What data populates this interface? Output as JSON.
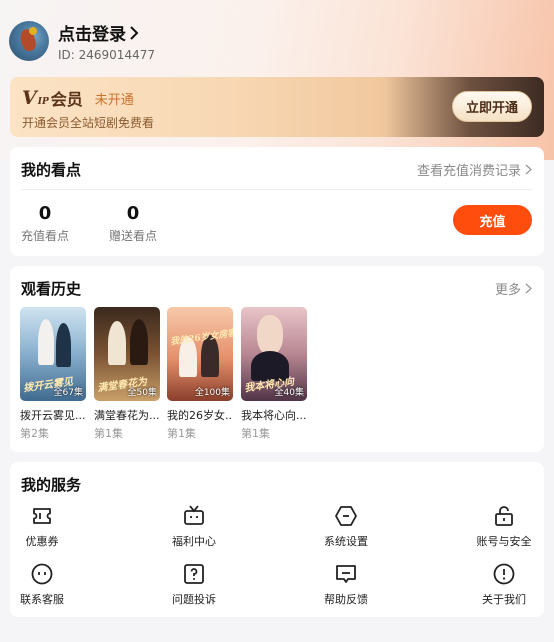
{
  "profile": {
    "login_title": "点击登录",
    "uid": "ID: 2469014477"
  },
  "vip": {
    "badge_v": "V",
    "badge_ip": "IP",
    "name": "会员",
    "status": "未开通",
    "subtitle": "开通会员全站短剧免费看",
    "button": "立即开通"
  },
  "points": {
    "title": "我的看点",
    "link": "查看充值消费记录",
    "recharge_value": "0",
    "recharge_label": "充值看点",
    "gift_value": "0",
    "gift_label": "赠送看点",
    "button": "充值"
  },
  "history": {
    "title": "观看历史",
    "link": "更多",
    "items": [
      {
        "title": "拨开云雾见...",
        "episode": "第2集",
        "badge": "全67集",
        "caption": "拨开云雾见"
      },
      {
        "title": "满堂春花为...",
        "episode": "第1集",
        "badge": "全50集",
        "caption": "满堂春花为"
      },
      {
        "title": "我的26岁女...",
        "episode": "第1集",
        "badge": "全100集",
        "caption": "我的26岁女房客"
      },
      {
        "title": "我本将心向...",
        "episode": "第1集",
        "badge": "全40集",
        "caption": "我本将心向"
      }
    ]
  },
  "services": {
    "title": "我的服务",
    "items": [
      {
        "label": "优惠券",
        "icon": "ticket-icon"
      },
      {
        "label": "福利中心",
        "icon": "tv-icon"
      },
      {
        "label": "系统设置",
        "icon": "settings-icon"
      },
      {
        "label": "账号与安全",
        "icon": "lock-icon"
      },
      {
        "label": "联系客服",
        "icon": "customer-service-icon"
      },
      {
        "label": "问题投诉",
        "icon": "complaint-icon"
      },
      {
        "label": "帮助反馈",
        "icon": "feedback-icon"
      },
      {
        "label": "关于我们",
        "icon": "info-icon"
      }
    ]
  },
  "colors": {
    "accent": "#ff4d0d",
    "vip_text": "#5a3318",
    "vip_status": "#c7732e"
  }
}
